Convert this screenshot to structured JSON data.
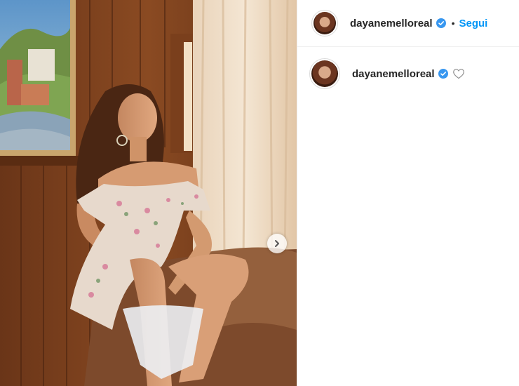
{
  "post": {
    "username": "dayanemelloreal",
    "follow_label": "Segui",
    "separator": "•"
  },
  "caption": {
    "username": "dayanemelloreal"
  },
  "icons": {
    "verified": "verified-badge-icon",
    "like": "heart-outline-icon",
    "next": "chevron-right-icon"
  },
  "colors": {
    "accent": "#0095f6",
    "verified": "#3897f0"
  }
}
